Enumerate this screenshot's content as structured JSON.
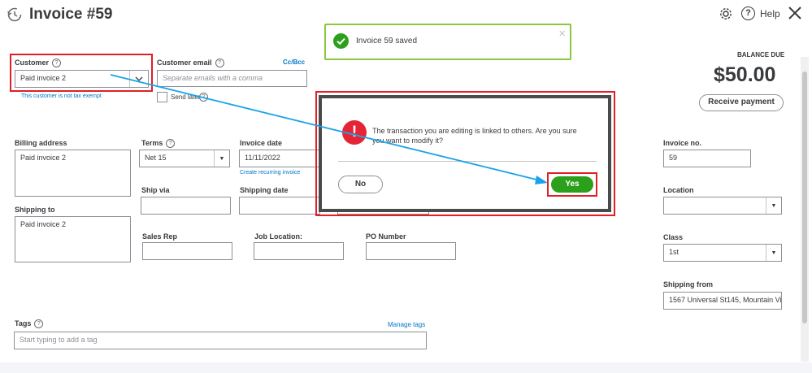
{
  "header": {
    "title": "Invoice #59",
    "help_label": "Help"
  },
  "toast": {
    "message": "Invoice 59 saved"
  },
  "customer": {
    "label": "Customer",
    "value": "Paid invoice 2",
    "tax_note": "This customer is not tax exempt"
  },
  "customer_email": {
    "label": "Customer email",
    "placeholder": "Separate emails with a comma",
    "cc_bcc": "Cc/Bcc",
    "send_later": "Send later"
  },
  "balance": {
    "label": "BALANCE DUE",
    "amount": "$50.00",
    "receive_payment": "Receive payment"
  },
  "billing_address": {
    "label": "Billing address",
    "value": "Paid invoice 2"
  },
  "terms": {
    "label": "Terms",
    "value": "Net 15"
  },
  "invoice_date": {
    "label": "Invoice date",
    "value": "11/11/2022",
    "recurring_link": "Create recurring invoice"
  },
  "invoice_no": {
    "label": "Invoice no.",
    "value": "59"
  },
  "ship_via": {
    "label": "Ship via"
  },
  "shipping_date": {
    "label": "Shipping date"
  },
  "location": {
    "label": "Location"
  },
  "shipping_to": {
    "label": "Shipping to",
    "value": "Paid invoice 2"
  },
  "sales_rep": {
    "label": "Sales Rep"
  },
  "job_location": {
    "label": "Job Location:"
  },
  "po_number": {
    "label": "PO Number"
  },
  "class_field": {
    "label": "Class",
    "value": "1st"
  },
  "shipping_from": {
    "label": "Shipping from",
    "value": "1567 Universal St145, Mountain Vi"
  },
  "tags": {
    "label": "Tags",
    "manage": "Manage tags",
    "placeholder": "Start typing to add a tag"
  },
  "modal": {
    "message": "The transaction you are editing is linked to others. Are you sure you want to modify it?",
    "no_label": "No",
    "yes_label": "Yes"
  },
  "colors": {
    "accent_green": "#2ca01c",
    "annotation_red": "#e01f26",
    "annotation_arrow": "#1aa3e8",
    "link_blue": "#0077c5",
    "warning_red": "#e52535"
  }
}
